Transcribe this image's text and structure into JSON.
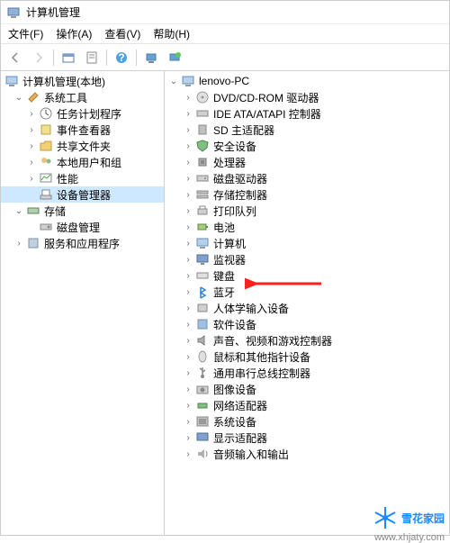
{
  "title": "计算机管理",
  "menu": {
    "file": "文件(F)",
    "action": "操作(A)",
    "view": "查看(V)",
    "help": "帮助(H)"
  },
  "left_root": "计算机管理(本地)",
  "left": {
    "system_tools": "系统工具",
    "task_scheduler": "任务计划程序",
    "event_viewer": "事件查看器",
    "shared_folders": "共享文件夹",
    "local_users": "本地用户和组",
    "performance": "性能",
    "device_manager": "设备管理器",
    "storage": "存储",
    "disk_management": "磁盘管理",
    "services": "服务和应用程序"
  },
  "right_root": "lenovo-PC",
  "devices": [
    {
      "icon": "disc",
      "label": "DVD/CD-ROM 驱动器"
    },
    {
      "icon": "ide",
      "label": "IDE ATA/ATAPI 控制器"
    },
    {
      "icon": "sd",
      "label": "SD 主适配器"
    },
    {
      "icon": "shield",
      "label": "安全设备"
    },
    {
      "icon": "cpu",
      "label": "处理器"
    },
    {
      "icon": "disk",
      "label": "磁盘驱动器"
    },
    {
      "icon": "storage",
      "label": "存储控制器"
    },
    {
      "icon": "printer",
      "label": "打印队列"
    },
    {
      "icon": "battery",
      "label": "电池"
    },
    {
      "icon": "computer",
      "label": "计算机"
    },
    {
      "icon": "monitor",
      "label": "监视器"
    },
    {
      "icon": "keyboard",
      "label": "键盘",
      "highlight": true
    },
    {
      "icon": "bluetooth",
      "label": "蓝牙"
    },
    {
      "icon": "hid",
      "label": "人体学输入设备"
    },
    {
      "icon": "software",
      "label": "软件设备"
    },
    {
      "icon": "sound",
      "label": "声音、视频和游戏控制器"
    },
    {
      "icon": "mouse",
      "label": "鼠标和其他指针设备"
    },
    {
      "icon": "usb",
      "label": "通用串行总线控制器"
    },
    {
      "icon": "imaging",
      "label": "图像设备"
    },
    {
      "icon": "network",
      "label": "网络适配器"
    },
    {
      "icon": "system",
      "label": "系统设备"
    },
    {
      "icon": "display",
      "label": "显示适配器"
    },
    {
      "icon": "audio",
      "label": "音频输入和输出"
    }
  ],
  "watermark": {
    "text": "雪花家园",
    "url": "www.xhjaty.com"
  }
}
